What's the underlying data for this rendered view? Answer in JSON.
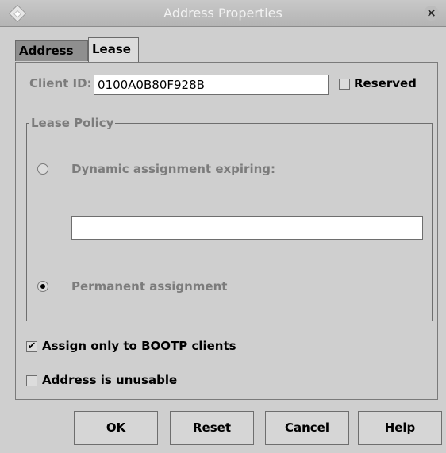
{
  "window": {
    "title": "Address Properties"
  },
  "tabs": [
    {
      "label": "Address"
    },
    {
      "label": "Lease"
    }
  ],
  "client_id": {
    "label": "Client ID:",
    "value": "0100A0B80F928B"
  },
  "reserved": {
    "label": "Reserved",
    "checked": false
  },
  "lease_policy": {
    "title": "Lease Policy",
    "dynamic_label": "Dynamic assignment expiring:",
    "dynamic_selected": false,
    "expiration_value": "",
    "permanent_label": "Permanent assignment",
    "permanent_selected": true
  },
  "bootp": {
    "label": "Assign only to BOOTP clients",
    "checked": true,
    "mark": "✔"
  },
  "unusable": {
    "label": "Address is unusable",
    "checked": false
  },
  "buttons": {
    "ok": "OK",
    "reset": "Reset",
    "cancel": "Cancel",
    "help": "Help"
  },
  "icons": {
    "close": "close-icon",
    "window": "window-menu-icon"
  }
}
